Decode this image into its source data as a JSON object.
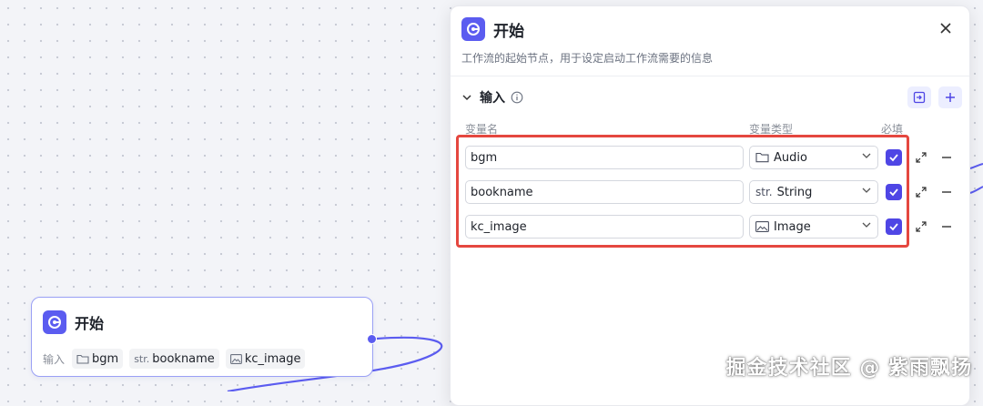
{
  "canvas_node": {
    "title": "开始",
    "inputs_label": "输入",
    "chips": [
      {
        "icon": "folder-icon",
        "label": "bgm"
      },
      {
        "icon": "string-type-icon",
        "label": "bookname",
        "prefix": "str."
      },
      {
        "icon": "image-icon",
        "label": "kc_image"
      }
    ]
  },
  "panel": {
    "title": "开始",
    "description": "工作流的起始节点，用于设定启动工作流需要的信息",
    "section_title": "输入",
    "columns": {
      "name": "变量名",
      "type": "变量类型",
      "required": "必填"
    },
    "variables": [
      {
        "name": "bgm",
        "type": "Audio",
        "type_icon": "folder-icon",
        "required": true
      },
      {
        "name": "bookname",
        "type": "String",
        "type_icon": "string-type-icon",
        "type_prefix": "str.",
        "required": true
      },
      {
        "name": "kc_image",
        "type": "Image",
        "type_icon": "image-icon",
        "required": true
      }
    ]
  },
  "watermark": "掘金技术社区 @ 紫雨飘扬",
  "colors": {
    "accent": "#5b5cf0",
    "checkbox": "#4f46e5",
    "highlight": "#e5473f"
  }
}
